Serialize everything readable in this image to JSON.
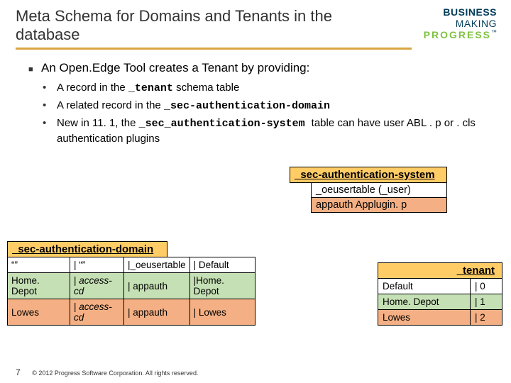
{
  "header": {
    "title": "Meta Schema for Domains and Tenants in the database",
    "brand": {
      "l1": "BUSINESS",
      "l2": "MAKING",
      "l3": "PROGRESS",
      "tm": "™"
    }
  },
  "bullets": {
    "main": "An Open.Edge Tool creates a Tenant by providing:",
    "sub1_a": "A record in the ",
    "sub1_b": "_tenant",
    "sub1_c": " schema table",
    "sub2_a": "A related record in the ",
    "sub2_b": "_sec-authentication-domain",
    "sub3_a": "New in 11. 1, the ",
    "sub3_b": "_sec_authentication-system ",
    "sub3_c": "table can have user  ABL  . p or . cls authentication  plugins"
  },
  "sys": {
    "header": "_sec-authentication-system",
    "row2": "_oeusertable (_user)",
    "row3": "appauth   Applugin. p"
  },
  "domain": {
    "header": "_sec-authentication-domain",
    "rows": [
      {
        "c0": "“”",
        "c1": "“”",
        "c2": "_oeusertable",
        "c3": "Default"
      },
      {
        "c0": "Home. Depot",
        "c1": "access-cd",
        "c2": "appauth",
        "c3": "Home. Depot"
      },
      {
        "c0": "Lowes",
        "c1": "access-cd",
        "c2": "appauth",
        "c3": "Lowes"
      }
    ]
  },
  "tenant": {
    "header": "_tenant",
    "rows": [
      {
        "c0": "Default",
        "c1": "0"
      },
      {
        "c0": "Home. Depot",
        "c1": "1"
      },
      {
        "c0": "Lowes",
        "c1": "2"
      }
    ]
  },
  "footer": {
    "page": "7",
    "copy": "© 2012 Progress Software Corporation. All rights reserved."
  }
}
